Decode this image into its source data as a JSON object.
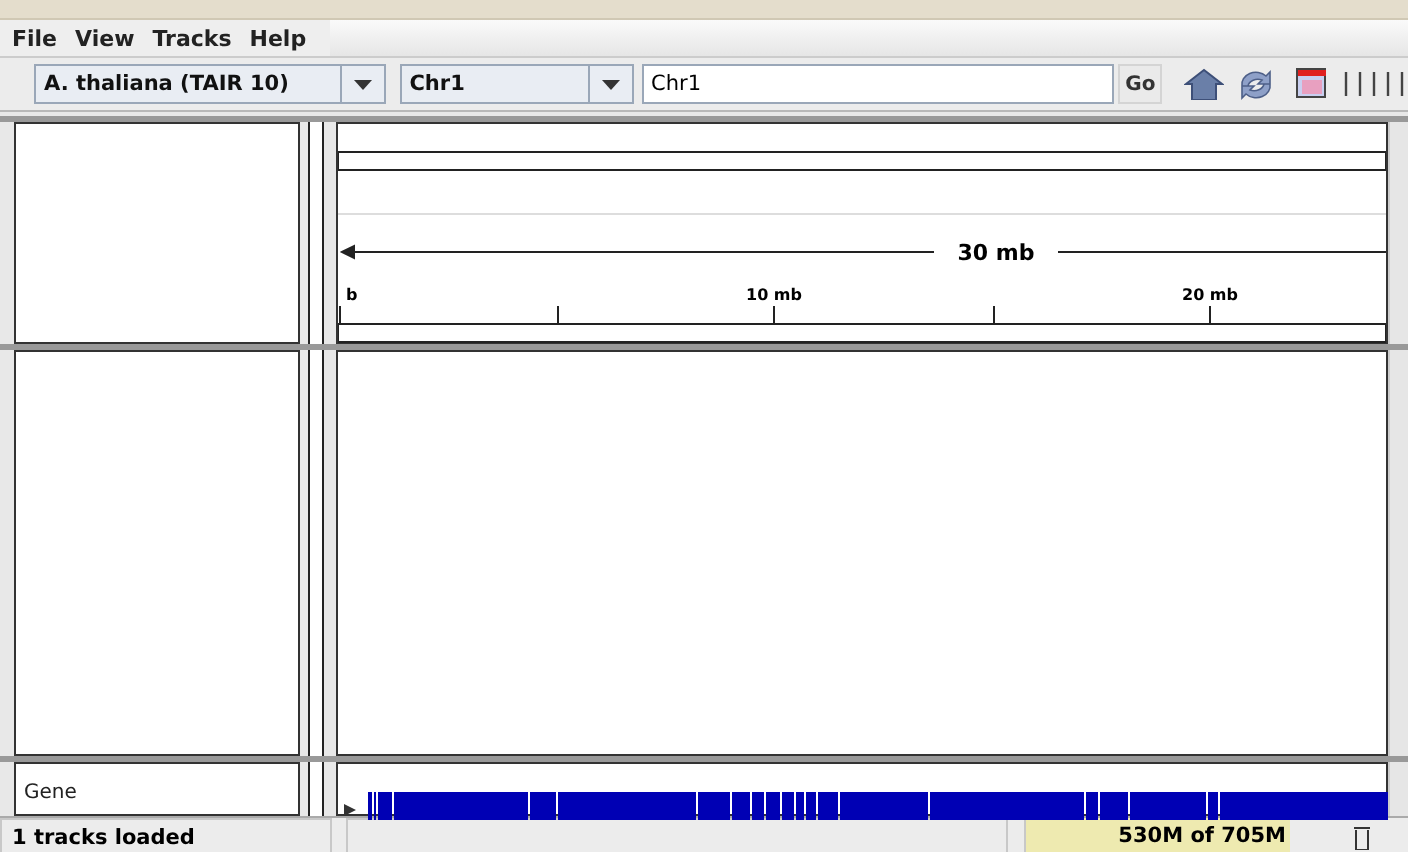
{
  "menu": [
    {
      "label": "File"
    },
    {
      "label": "View"
    },
    {
      "label": "Tracks"
    },
    {
      "label": "Help"
    }
  ],
  "toolbar": {
    "genome": "A. thaliana (TAIR 10)",
    "chromosome": "Chr1",
    "locus": "Chr1",
    "go": "Go"
  },
  "ruler": {
    "span": "30 mb",
    "labels": [
      {
        "text": "b"
      },
      {
        "text": "10 mb"
      },
      {
        "text": "20 mb"
      }
    ]
  },
  "feature_tracks": [
    {
      "name": "Gene"
    }
  ],
  "status_bar": {
    "message": "1 tracks loaded",
    "memory": "530M of 705M"
  }
}
